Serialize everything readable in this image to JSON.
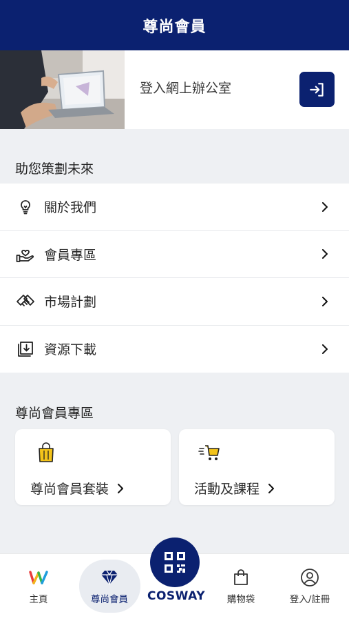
{
  "header": {
    "title": "尊尚會員"
  },
  "login_banner": {
    "text": "登入網上辦公室",
    "button_icon": "login-arrow-icon"
  },
  "section_future": {
    "title": "助您策劃未來"
  },
  "menu": [
    {
      "label": "關於我們",
      "icon": "lightbulb-icon"
    },
    {
      "label": "會員專區",
      "icon": "hand-heart-icon"
    },
    {
      "label": "市場計劃",
      "icon": "handshake-icon"
    },
    {
      "label": "資源下載",
      "icon": "download-box-icon"
    }
  ],
  "section_member": {
    "title": "尊尚會員專區"
  },
  "cards": [
    {
      "label": "尊尚會員套裝",
      "icon": "shopping-bag-icon"
    },
    {
      "label": "活動及課程",
      "icon": "cart-icon"
    }
  ],
  "tabbar": {
    "items": [
      {
        "label": "主頁",
        "icon": "home-w-logo-icon"
      },
      {
        "label": "尊尚會員",
        "icon": "diamond-icon",
        "active": true
      },
      {
        "label": "購物袋",
        "icon": "bag-icon"
      },
      {
        "label": "登入/註冊",
        "icon": "user-circle-icon"
      }
    ],
    "center": {
      "icon": "qr-code-icon",
      "logo": "COSWAY"
    }
  },
  "colors": {
    "brand": "#0b2170",
    "background": "#eef0f3",
    "accent_yellow": "#f3c31a"
  }
}
